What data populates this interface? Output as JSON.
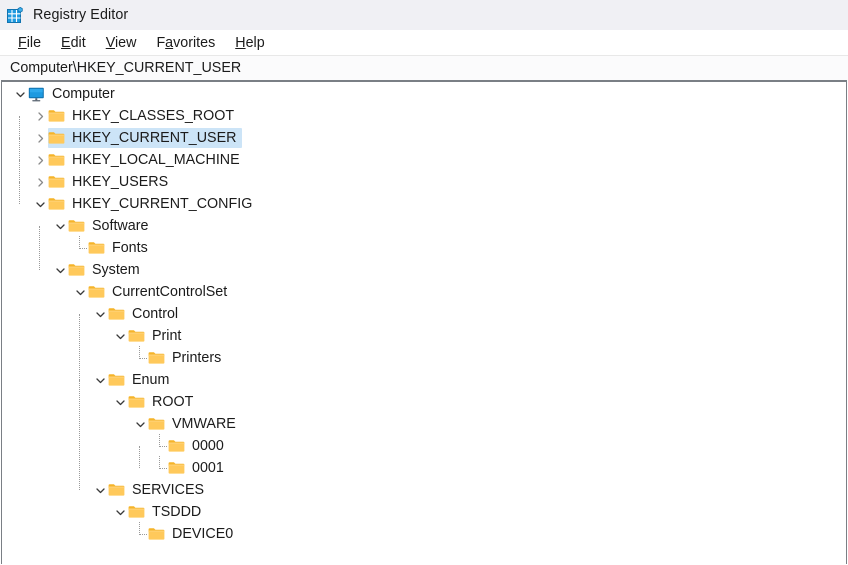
{
  "window": {
    "title": "Registry Editor",
    "icon": "registry-editor-icon"
  },
  "menubar": {
    "items": [
      {
        "label": "File",
        "access_key": "F",
        "pre": "",
        "post": "ile"
      },
      {
        "label": "Edit",
        "access_key": "E",
        "pre": "",
        "post": "dit"
      },
      {
        "label": "View",
        "access_key": "V",
        "pre": "",
        "post": "iew"
      },
      {
        "label": "Favorites",
        "access_key": "a",
        "pre": "F",
        "post": "vorites"
      },
      {
        "label": "Help",
        "access_key": "H",
        "pre": "",
        "post": "elp"
      }
    ]
  },
  "address_bar": {
    "path": "Computer\\HKEY_CURRENT_USER"
  },
  "colors": {
    "titlebar_bg": "#f0f0f4",
    "selection_bg": "#cce4f7",
    "folder_fill": "#ffc95b",
    "folder_back": "#f5b429",
    "monitor_blue": "#1e9ae0",
    "panel_border": "#7a7f85",
    "guide_line": "#9a9a9a"
  },
  "tree": {
    "nodes": [
      {
        "id": "computer",
        "label": "Computer",
        "depth": 0,
        "icon": "monitor-icon",
        "state": "expanded",
        "selected": false
      },
      {
        "id": "hkey-classes-root",
        "label": "HKEY_CLASSES_ROOT",
        "depth": 1,
        "icon": "folder-icon",
        "state": "collapsed",
        "selected": false
      },
      {
        "id": "hkey-current-user",
        "label": "HKEY_CURRENT_USER",
        "depth": 1,
        "icon": "folder-icon",
        "state": "collapsed",
        "selected": true
      },
      {
        "id": "hkey-local-machine",
        "label": "HKEY_LOCAL_MACHINE",
        "depth": 1,
        "icon": "folder-icon",
        "state": "collapsed",
        "selected": false
      },
      {
        "id": "hkey-users",
        "label": "HKEY_USERS",
        "depth": 1,
        "icon": "folder-icon",
        "state": "collapsed",
        "selected": false
      },
      {
        "id": "hkey-current-config",
        "label": "HKEY_CURRENT_CONFIG",
        "depth": 1,
        "icon": "folder-icon",
        "state": "expanded",
        "selected": false
      },
      {
        "id": "software",
        "label": "Software",
        "depth": 2,
        "icon": "folder-icon",
        "state": "expanded",
        "selected": false
      },
      {
        "id": "fonts",
        "label": "Fonts",
        "depth": 3,
        "icon": "folder-icon",
        "state": "leaf",
        "selected": false
      },
      {
        "id": "system",
        "label": "System",
        "depth": 2,
        "icon": "folder-icon",
        "state": "expanded",
        "selected": false
      },
      {
        "id": "currentcontrolset",
        "label": "CurrentControlSet",
        "depth": 3,
        "icon": "folder-icon",
        "state": "expanded",
        "selected": false
      },
      {
        "id": "control",
        "label": "Control",
        "depth": 4,
        "icon": "folder-icon",
        "state": "expanded",
        "selected": false
      },
      {
        "id": "print",
        "label": "Print",
        "depth": 5,
        "icon": "folder-icon",
        "state": "expanded",
        "selected": false
      },
      {
        "id": "printers",
        "label": "Printers",
        "depth": 6,
        "icon": "folder-icon",
        "state": "leaf",
        "selected": false
      },
      {
        "id": "enum",
        "label": "Enum",
        "depth": 4,
        "icon": "folder-icon",
        "state": "expanded",
        "selected": false
      },
      {
        "id": "root",
        "label": "ROOT",
        "depth": 5,
        "icon": "folder-icon",
        "state": "expanded",
        "selected": false
      },
      {
        "id": "vmware",
        "label": "VMWARE",
        "depth": 6,
        "icon": "folder-icon",
        "state": "expanded",
        "selected": false
      },
      {
        "id": "vmware-0000",
        "label": "0000",
        "depth": 7,
        "icon": "folder-icon",
        "state": "leaf",
        "selected": false
      },
      {
        "id": "vmware-0001",
        "label": "0001",
        "depth": 7,
        "icon": "folder-icon",
        "state": "leaf",
        "selected": false
      },
      {
        "id": "services",
        "label": "SERVICES",
        "depth": 4,
        "icon": "folder-icon",
        "state": "expanded",
        "selected": false
      },
      {
        "id": "tsddd",
        "label": "TSDDD",
        "depth": 5,
        "icon": "folder-icon",
        "state": "expanded",
        "selected": false
      },
      {
        "id": "device0",
        "label": "DEVICE0",
        "depth": 6,
        "icon": "folder-icon",
        "state": "leaf",
        "selected": false
      }
    ]
  }
}
